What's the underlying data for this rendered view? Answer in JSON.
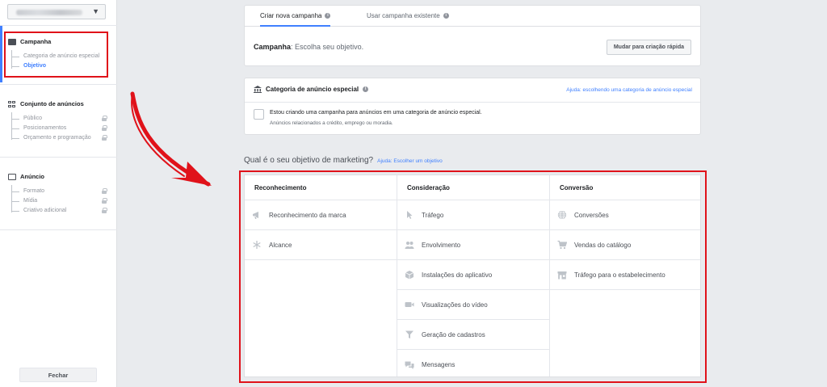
{
  "sidebar": {
    "sections": [
      {
        "title": "Campanha",
        "items": [
          {
            "label": "Categoria de anúncio especial"
          },
          {
            "label": "Objetivo"
          }
        ]
      },
      {
        "title": "Conjunto de anúncios",
        "items": [
          {
            "label": "Público"
          },
          {
            "label": "Posicionamentos"
          },
          {
            "label": "Orçamento e programação"
          }
        ]
      },
      {
        "title": "Anúncio",
        "items": [
          {
            "label": "Formato"
          },
          {
            "label": "Mídia"
          },
          {
            "label": "Criativo adicional"
          }
        ]
      }
    ],
    "close_label": "Fechar"
  },
  "tabs": [
    {
      "label": "Criar nova campanha"
    },
    {
      "label": "Usar campanha existente"
    }
  ],
  "campaign": {
    "label": "Campanha",
    "text": ": Escolha seu objetivo.",
    "quick_button": "Mudar para criação rápida"
  },
  "special_category": {
    "title": "Categoria de anúncio especial",
    "help_link": "Ajuda: escolhendo uma categoria de anúncio especial",
    "checkbox_text": "Estou criando uma campanha para anúncios em uma categoria de anúncio especial.",
    "checkbox_subtext": "Anúncios relacionados a crédito, emprego ou moradia."
  },
  "objectives": {
    "question": "Qual é o seu objetivo de marketing?",
    "help_link": "Ajuda: Escolher um objetivo",
    "columns": [
      {
        "title": "Reconhecimento",
        "items": [
          {
            "label": "Reconhecimento da marca",
            "icon": "megaphone-icon"
          },
          {
            "label": "Alcance",
            "icon": "snowflake-icon"
          }
        ]
      },
      {
        "title": "Consideração",
        "items": [
          {
            "label": "Tráfego",
            "icon": "cursor-icon"
          },
          {
            "label": "Envolvimento",
            "icon": "people-icon"
          },
          {
            "label": "Instalações do aplicativo",
            "icon": "box-icon"
          },
          {
            "label": "Visualizações do vídeo",
            "icon": "video-camera-icon"
          },
          {
            "label": "Geração de cadastros",
            "icon": "funnel-icon"
          },
          {
            "label": "Mensagens",
            "icon": "chat-bubbles-icon"
          }
        ]
      },
      {
        "title": "Conversão",
        "items": [
          {
            "label": "Conversões",
            "icon": "globe-icon"
          },
          {
            "label": "Vendas do catálogo",
            "icon": "shopping-cart-icon"
          },
          {
            "label": "Tráfego para o estabelecimento",
            "icon": "store-icon"
          }
        ]
      }
    ]
  },
  "colors": {
    "accent": "#4080ff",
    "highlight": "#e0121a",
    "icon": "#bec3c9"
  }
}
